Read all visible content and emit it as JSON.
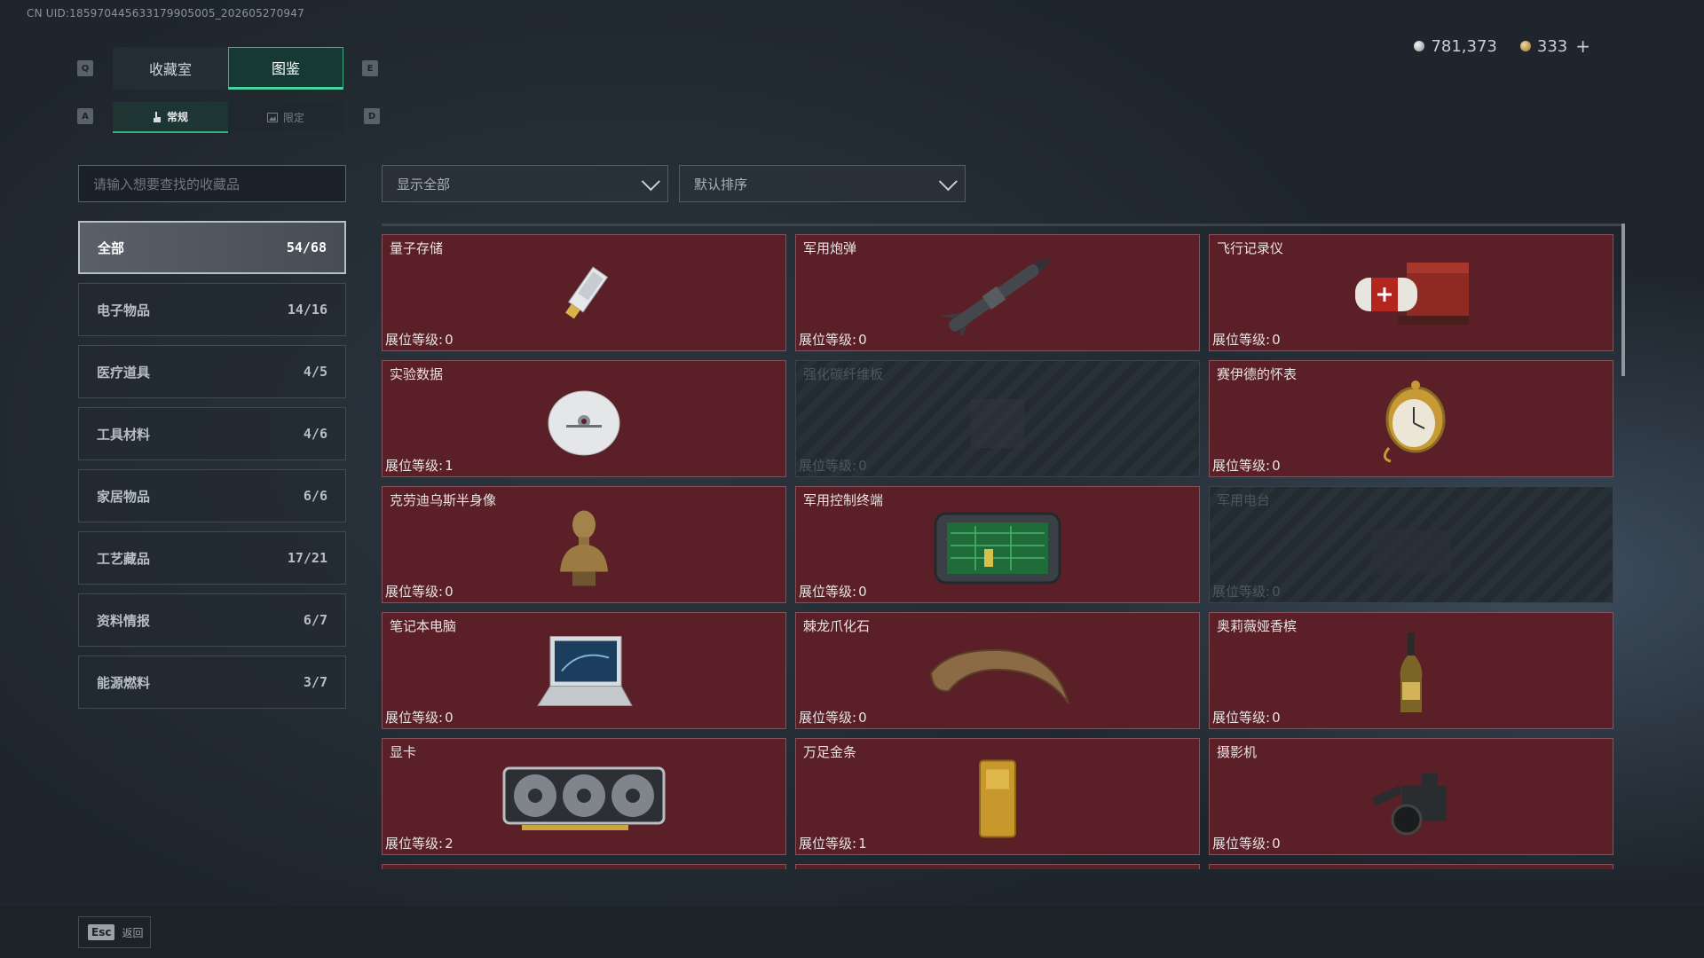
{
  "uid": "CN UID:185970445633179905005_202605270947",
  "currency": [
    {
      "type": "silver",
      "value": "781,373"
    },
    {
      "type": "gold",
      "value": "333",
      "plus": "+"
    }
  ],
  "keys": {
    "q": "Q",
    "e": "E",
    "a": "A",
    "d": "D",
    "esc": "Esc"
  },
  "tabs": [
    {
      "label": "收藏室",
      "active": false
    },
    {
      "label": "图鉴",
      "active": true
    }
  ],
  "subtabs": [
    {
      "label": "常规",
      "icon": "hand-icon",
      "active": true
    },
    {
      "label": "限定",
      "icon": "image-icon",
      "active": false
    }
  ],
  "search": {
    "placeholder": "请输入想要查找的收藏品"
  },
  "filters": {
    "show": "显示全部",
    "sort": "默认排序"
  },
  "categories": [
    {
      "label": "全部",
      "count": "54/68",
      "active": true
    },
    {
      "label": "电子物品",
      "count": "14/16"
    },
    {
      "label": "医疗道具",
      "count": "4/5"
    },
    {
      "label": "工具材料",
      "count": "4/6"
    },
    {
      "label": "家居物品",
      "count": "6/6"
    },
    {
      "label": "工艺藏品",
      "count": "17/21"
    },
    {
      "label": "资料情报",
      "count": "6/7"
    },
    {
      "label": "能源燃料",
      "count": "3/7"
    }
  ],
  "level_label": "展位等级:",
  "items": [
    {
      "name": "量子存储",
      "level": "0",
      "locked": false,
      "icon": "usb-drive-icon"
    },
    {
      "name": "军用炮弹",
      "level": "0",
      "locked": false,
      "icon": "missile-icon"
    },
    {
      "name": "飞行记录仪",
      "level": "0",
      "locked": false,
      "icon": "flight-recorder-icon"
    },
    {
      "name": "实验数据",
      "level": "1",
      "locked": false,
      "icon": "disc-icon"
    },
    {
      "name": "强化碳纤维板",
      "level": "0",
      "locked": true,
      "icon": "carbon-plate-icon"
    },
    {
      "name": "赛伊德的怀表",
      "level": "0",
      "locked": false,
      "icon": "pocket-watch-icon"
    },
    {
      "name": "克劳迪乌斯半身像",
      "level": "0",
      "locked": false,
      "icon": "bust-icon"
    },
    {
      "name": "军用控制终端",
      "level": "0",
      "locked": false,
      "icon": "control-terminal-icon"
    },
    {
      "name": "军用电台",
      "level": "0",
      "locked": true,
      "icon": "radio-icon"
    },
    {
      "name": "笔记本电脑",
      "level": "0",
      "locked": false,
      "icon": "laptop-icon"
    },
    {
      "name": "棘龙爪化石",
      "level": "0",
      "locked": false,
      "icon": "claw-fossil-icon"
    },
    {
      "name": "奥莉薇娅香槟",
      "level": "0",
      "locked": false,
      "icon": "champagne-icon"
    },
    {
      "name": "显卡",
      "level": "2",
      "locked": false,
      "icon": "graphics-card-icon"
    },
    {
      "name": "万足金条",
      "level": "1",
      "locked": false,
      "icon": "gold-bar-icon"
    },
    {
      "name": "摄影机",
      "level": "0",
      "locked": false,
      "icon": "camera-icon"
    }
  ],
  "footer": {
    "back_label": "返回"
  },
  "colors": {
    "accent": "#47d79e",
    "card_bg": "#5a1f27",
    "card_border": "#8a5058"
  }
}
